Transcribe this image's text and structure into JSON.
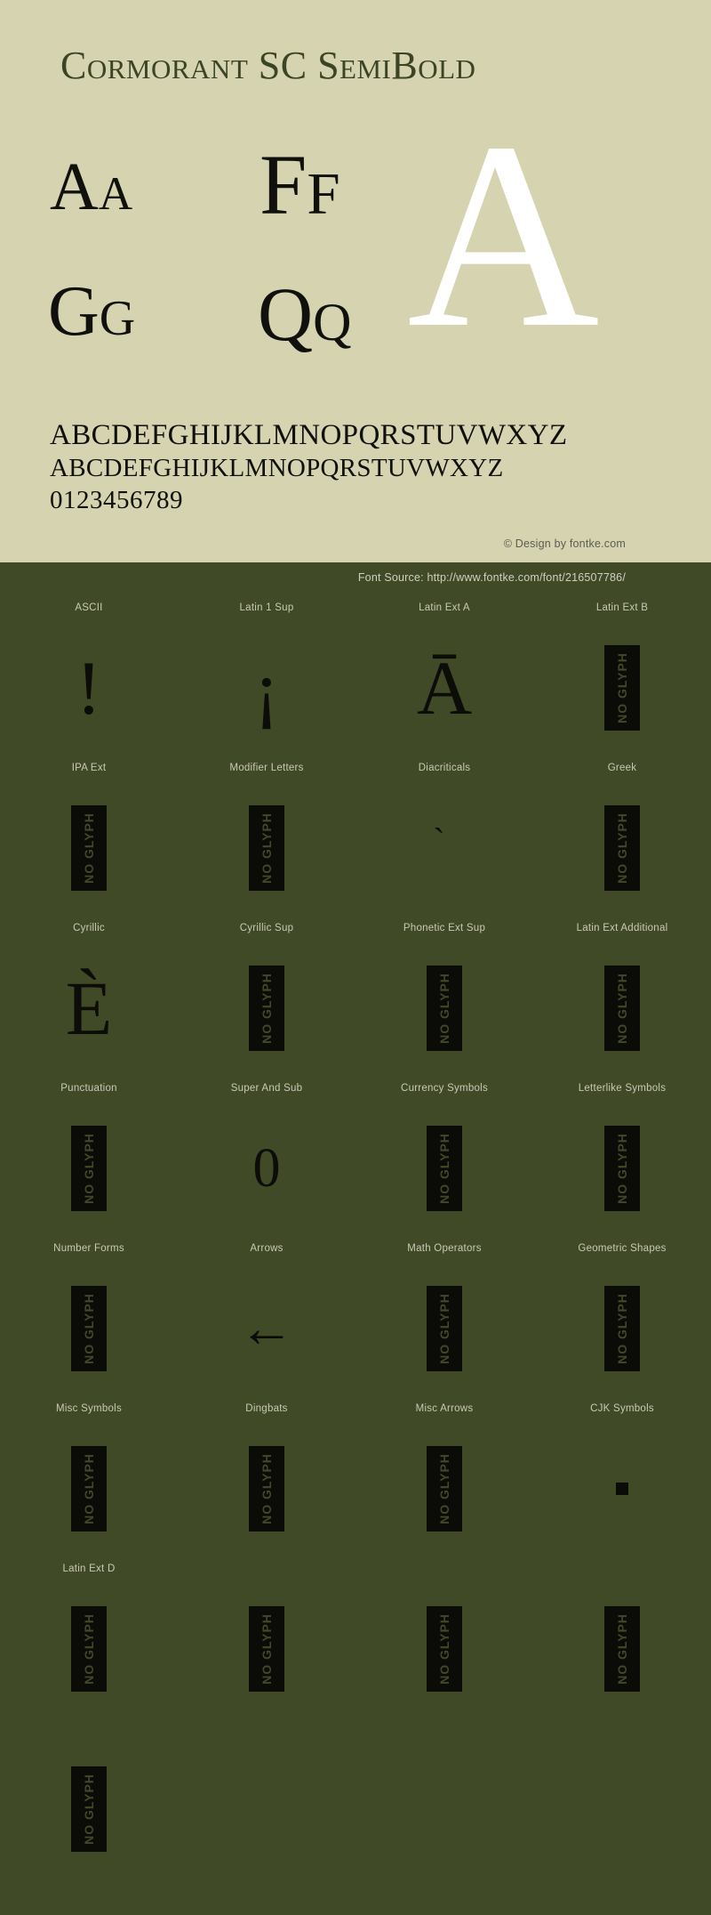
{
  "specimen": {
    "title": "Cormorant SC SemiBold",
    "samples": [
      {
        "name": "sample-aa",
        "text": "Aa"
      },
      {
        "name": "sample-ff",
        "text": "Ff"
      },
      {
        "name": "sample-gg",
        "text": "Gg"
      },
      {
        "name": "sample-qq",
        "text": "Qq"
      },
      {
        "name": "sample-big-a",
        "text": "A"
      }
    ],
    "alphabet_upper": "ABCDEFGHIJKLMNOPQRSTUVWXYZ",
    "alphabet_small": "ABCDEFGHIJKLMNOPQRSTUVWXYZ",
    "digits": "0123456789",
    "copyright": "© Design by fontke.com",
    "font_source": "Font Source: http://www.fontke.com/font/216507786/"
  },
  "colors": {
    "specimen_bg": "#d5d3b0",
    "coverage_bg": "#414a26",
    "title_color": "#3b4425",
    "glyph_color": "#0c0c08",
    "big_glyph_color": "#ffffff",
    "label_color": "#c9c9b6"
  },
  "coverage": {
    "rows": [
      {
        "cells": [
          {
            "label": "ASCII",
            "kind": "glyph",
            "glyph": "!",
            "size": "lg"
          },
          {
            "label": "Latin 1 Sup",
            "kind": "glyph",
            "glyph": "¡",
            "size": "lg"
          },
          {
            "label": "Latin Ext A",
            "kind": "glyph",
            "glyph": "Ā",
            "size": "lg"
          },
          {
            "label": "Latin Ext B",
            "kind": "noglyph",
            "glyph": "NO GLYPH"
          }
        ]
      },
      {
        "cells": [
          {
            "label": "IPA Ext",
            "kind": "noglyph",
            "glyph": "NO GLYPH"
          },
          {
            "label": "Modifier Letters",
            "kind": "noglyph",
            "glyph": "NO GLYPH"
          },
          {
            "label": "Diacriticals",
            "kind": "glyph",
            "glyph": "̀",
            "size": "xs"
          },
          {
            "label": "Greek",
            "kind": "noglyph",
            "glyph": "NO GLYPH"
          }
        ]
      },
      {
        "cells": [
          {
            "label": "Cyrillic",
            "kind": "glyph",
            "glyph": "È",
            "size": "lg"
          },
          {
            "label": "Cyrillic Sup",
            "kind": "noglyph",
            "glyph": "NO GLYPH"
          },
          {
            "label": "Phonetic Ext Sup",
            "kind": "noglyph",
            "glyph": "NO GLYPH"
          },
          {
            "label": "Latin Ext Additional",
            "kind": "noglyph",
            "glyph": "NO GLYPH"
          }
        ]
      },
      {
        "cells": [
          {
            "label": "Punctuation",
            "kind": "noglyph",
            "glyph": "NO GLYPH"
          },
          {
            "label": "Super And Sub",
            "kind": "glyph",
            "glyph": "0",
            "size": "sm"
          },
          {
            "label": "Currency Symbols",
            "kind": "noglyph",
            "glyph": "NO GLYPH"
          },
          {
            "label": "Letterlike Symbols",
            "kind": "noglyph",
            "glyph": "NO GLYPH"
          }
        ]
      },
      {
        "cells": [
          {
            "label": "Number Forms",
            "kind": "noglyph",
            "glyph": "NO GLYPH"
          },
          {
            "label": "Arrows",
            "kind": "arrow",
            "glyph": "←"
          },
          {
            "label": "Math Operators",
            "kind": "noglyph",
            "glyph": "NO GLYPH"
          },
          {
            "label": "Geometric Shapes",
            "kind": "noglyph",
            "glyph": "NO GLYPH"
          }
        ]
      },
      {
        "cells": [
          {
            "label": "Misc Symbols",
            "kind": "noglyph",
            "glyph": "NO GLYPH"
          },
          {
            "label": "Dingbats",
            "kind": "noglyph",
            "glyph": "NO GLYPH"
          },
          {
            "label": "Misc Arrows",
            "kind": "noglyph",
            "glyph": "NO GLYPH"
          },
          {
            "label": "CJK Symbols",
            "kind": "square",
            "glyph": ""
          }
        ]
      },
      {
        "cells": [
          {
            "label": "Latin Ext D",
            "kind": "noglyph",
            "glyph": "NO GLYPH"
          },
          {
            "label": "",
            "kind": "noglyph",
            "glyph": "NO GLYPH"
          },
          {
            "label": "",
            "kind": "noglyph",
            "glyph": "NO GLYPH"
          },
          {
            "label": "",
            "kind": "noglyph",
            "glyph": "NO GLYPH"
          }
        ]
      },
      {
        "cells": [
          {
            "label": "",
            "kind": "noglyph",
            "glyph": "NO GLYPH"
          },
          {
            "label": "",
            "kind": "empty",
            "glyph": ""
          },
          {
            "label": "",
            "kind": "empty",
            "glyph": ""
          },
          {
            "label": "",
            "kind": "empty",
            "glyph": ""
          }
        ]
      }
    ]
  }
}
